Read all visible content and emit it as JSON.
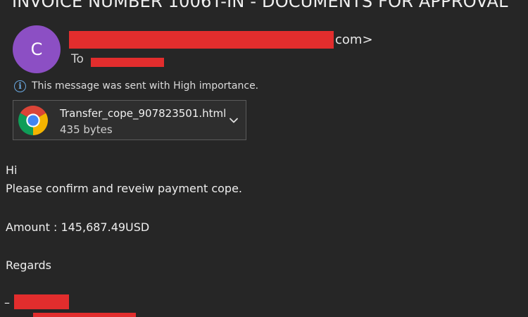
{
  "email": {
    "subject": "INVOICE NUMBER 1006T-IN - DOCUMENTS FOR APPROVAL",
    "avatar_initial": "C",
    "sender_domain_suffix": "com>",
    "to_label": "To",
    "importance_message": "This message was sent with High importance.",
    "attachment": {
      "file_name": "Transfer_cope_907823501.html",
      "file_size": "435 bytes",
      "icon": "chrome-icon"
    },
    "body": {
      "greeting": "Hi",
      "line1": "Please confirm and reveiw payment cope.",
      "amount_line": "Amount : 145,687.49USD",
      "closing": "Regards",
      "signature_dash": "–"
    }
  },
  "colors": {
    "background": "#262626",
    "avatar": "#8c4fc4",
    "redaction": "#e22d2d",
    "info_icon": "#6aa8e0"
  }
}
